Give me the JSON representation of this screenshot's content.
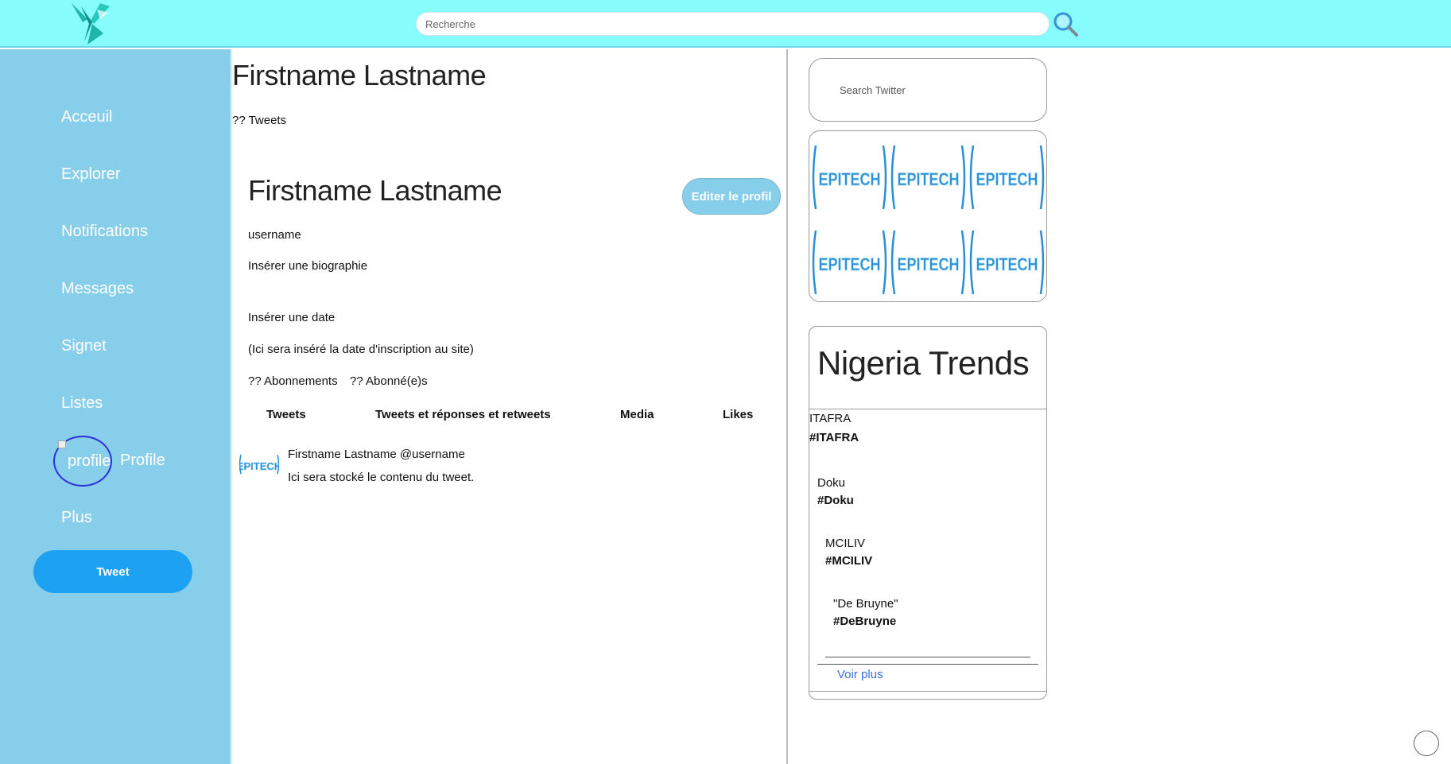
{
  "header": {
    "search_placeholder": "Recherche",
    "logo_icon": "twitter-x-logo-icon",
    "search_icon": "magnifier-icon",
    "colors": {
      "bar": "#86fcfc"
    }
  },
  "sidebar": {
    "items": [
      {
        "label": "Acceuil"
      },
      {
        "label": "Explorer"
      },
      {
        "label": "Notifications"
      },
      {
        "label": "Messages"
      },
      {
        "label": "Signet"
      },
      {
        "label": "Listes"
      },
      {
        "label": "Profile",
        "avatar_alt": "profile"
      },
      {
        "label": "Plus"
      }
    ],
    "tweet_button": "Tweet",
    "colors": {
      "background": "#87ceeb",
      "tweet_button": "#1da1f2"
    }
  },
  "profile": {
    "header_name": "Firstname Lastname",
    "tweet_count": "?? Tweets",
    "name": "Firstname Lastname",
    "edit_button": "Editer le profil",
    "username": "username",
    "bio": "Insérer une biographie",
    "date": "Insérer une date",
    "join_date": "(Ici sera inséré la date d'inscription au site)",
    "following": "?? Abonnements",
    "followers": "?? Abonné(e)s",
    "tabs": [
      "Tweets",
      "Tweets et réponses et retweets",
      "Media",
      "Likes"
    ]
  },
  "tweet": {
    "author": "Firstname Lastname @username",
    "content": "Ici sera stocké le contenu du tweet.",
    "avatar_text": "EPITECH"
  },
  "right": {
    "search_placeholder": "Search Twitter",
    "banner_text": "EPITECH",
    "trends_title": "Nigeria Trends",
    "trends": [
      {
        "name": "ITAFRA",
        "tag": "#ITAFRA"
      },
      {
        "name": "Doku",
        "tag": "#Doku"
      },
      {
        "name": "MCILIV",
        "tag": "#MCILIV"
      },
      {
        "name": "\"De Bruyne\"",
        "tag": "#DeBruyne"
      }
    ],
    "see_more": "Voir plus"
  }
}
